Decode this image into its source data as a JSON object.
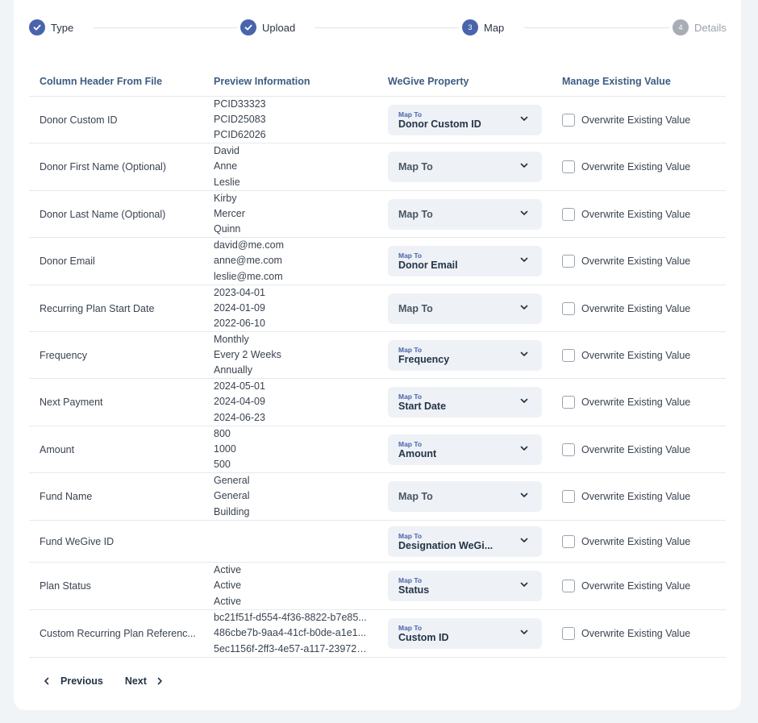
{
  "stepper": {
    "steps": [
      {
        "label": "Type",
        "state": "done",
        "number": "1"
      },
      {
        "label": "Upload",
        "state": "done",
        "number": "2"
      },
      {
        "label": "Map",
        "state": "active",
        "number": "3"
      },
      {
        "label": "Details",
        "state": "todo",
        "number": "4"
      }
    ]
  },
  "table": {
    "headers": {
      "column_header": "Column Header From File",
      "preview": "Preview Information",
      "property": "WeGive Property",
      "manage": "Manage Existing Value"
    },
    "select_caption": "Map To",
    "overwrite_label": "Overwrite Existing Value",
    "rows": [
      {
        "column": "Donor Custom ID",
        "preview": [
          "PCID33323",
          "PCID25083",
          "PCID62026"
        ],
        "mapped": "Donor Custom ID"
      },
      {
        "column": "Donor First Name (Optional)",
        "preview": [
          "David",
          "Anne",
          "Leslie"
        ],
        "mapped": ""
      },
      {
        "column": "Donor Last Name (Optional)",
        "preview": [
          "Kirby",
          "Mercer",
          "Quinn"
        ],
        "mapped": ""
      },
      {
        "column": "Donor Email",
        "preview": [
          "david@me.com",
          "anne@me.com",
          "leslie@me.com"
        ],
        "mapped": "Donor Email"
      },
      {
        "column": "Recurring Plan Start Date",
        "preview": [
          "2023-04-01",
          "2024-01-09",
          "2022-06-10"
        ],
        "mapped": ""
      },
      {
        "column": "Frequency",
        "preview": [
          "Monthly",
          "Every 2 Weeks",
          "Annually"
        ],
        "mapped": "Frequency"
      },
      {
        "column": "Next Payment",
        "preview": [
          "2024-05-01",
          "2024-04-09",
          "2024-06-23"
        ],
        "mapped": "Start Date"
      },
      {
        "column": "Amount",
        "preview": [
          "800",
          "1000",
          "500"
        ],
        "mapped": "Amount"
      },
      {
        "column": "Fund Name",
        "preview": [
          "General",
          "General",
          "Building"
        ],
        "mapped": ""
      },
      {
        "column": "Fund WeGive ID",
        "preview": [],
        "mapped": "Designation WeGi..."
      },
      {
        "column": "Plan Status",
        "preview": [
          "Active",
          "Active",
          "Active"
        ],
        "mapped": "Status"
      },
      {
        "column": "Custom Recurring Plan Referenc...",
        "preview": [
          "bc21f51f-d554-4f36-8822-b7e85...",
          "486cbe7b-9aa4-41cf-b0de-a1e1...",
          "5ec1156f-2ff3-4e57-a117-239720..."
        ],
        "mapped": "Custom ID"
      }
    ]
  },
  "pagination": {
    "previous_label": "Previous",
    "next_label": "Next"
  },
  "colors": {
    "accent": "#4a63ad",
    "header_text": "#3d5c82",
    "select_bg": "#eef2f6"
  }
}
